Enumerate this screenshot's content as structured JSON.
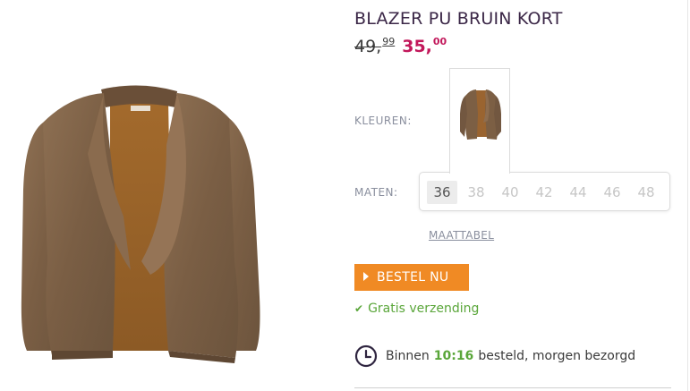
{
  "product": {
    "title": "BLAZER PU BRUIN KORT",
    "old_price_main": "49,",
    "old_price_cents": "99",
    "new_price_main": "35,",
    "new_price_cents": "00"
  },
  "colors": {
    "label": "KLEUREN:",
    "selected": "brown"
  },
  "sizes": {
    "label": "MATEN:",
    "options": [
      "36",
      "38",
      "40",
      "42",
      "44",
      "46",
      "48"
    ],
    "selected": "36",
    "chart_link": "MAATTABEL"
  },
  "actions": {
    "order_label": "BESTEL NU"
  },
  "shipping": {
    "text": "Gratis verzending"
  },
  "delivery": {
    "prefix": "Binnen",
    "time": "10:16",
    "suffix": "besteld, morgen bezorgd"
  },
  "palette": {
    "title": "#3b2747",
    "sale_price": "#c2185b",
    "order_button": "#f08a24",
    "green": "#5aa63a",
    "label": "#8a8f9e"
  }
}
